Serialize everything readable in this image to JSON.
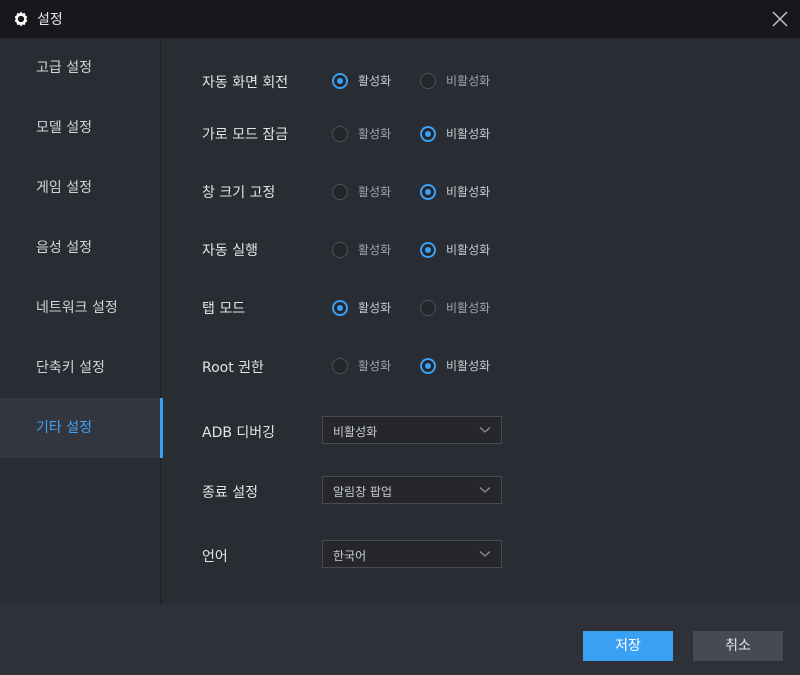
{
  "window": {
    "title": "설정"
  },
  "sidebar": {
    "items": [
      {
        "label": "고급 설정"
      },
      {
        "label": "모델 설정"
      },
      {
        "label": "게임 설정"
      },
      {
        "label": "음성 설정"
      },
      {
        "label": "네트워크 설정"
      },
      {
        "label": "단축키 설정"
      },
      {
        "label": "기타 설정",
        "active": true
      }
    ]
  },
  "settings": {
    "options": {
      "on": "활성화",
      "off": "비활성화"
    },
    "rows": [
      {
        "label": "자동 화면 회전",
        "selected": "on"
      },
      {
        "label": "가로 모드 잠금",
        "selected": "off"
      },
      {
        "label": "창 크기 고정",
        "selected": "off"
      },
      {
        "label": "자동 실행",
        "selected": "off"
      },
      {
        "label": "탭 모드",
        "selected": "on"
      },
      {
        "label": "Root 권한",
        "selected": "off"
      }
    ],
    "selects": [
      {
        "label": "ADB 디버깅",
        "value": "비활성화"
      },
      {
        "label": "종료 설정",
        "value": "알림창 팝업"
      },
      {
        "label": "언어",
        "value": "한국어"
      }
    ]
  },
  "footer": {
    "save_label": "저장",
    "cancel_label": "취소"
  },
  "colors": {
    "accent": "#3aa0f4",
    "background": "#2a2c33",
    "titlebar": "#17181c"
  }
}
